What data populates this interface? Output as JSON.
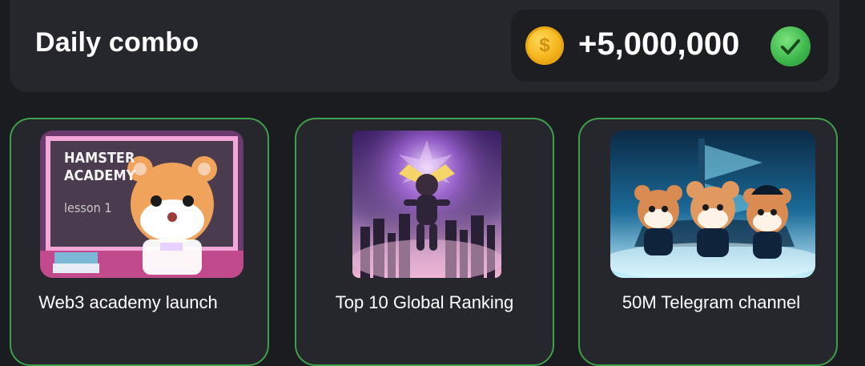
{
  "header": {
    "title": "Daily combo",
    "reward_amount": "+5,000,000",
    "coin_icon": "coin-icon",
    "check_icon": "check-circle-icon",
    "accent_color": "#3bb54a"
  },
  "cards": [
    {
      "label": "Web3 academy launch",
      "image_text": {
        "line1": "HAMSTER",
        "line2": "ACADEMY",
        "line3": "lesson 1"
      }
    },
    {
      "label": "Top 10 Global Ranking"
    },
    {
      "label": "50M Telegram channel"
    }
  ]
}
